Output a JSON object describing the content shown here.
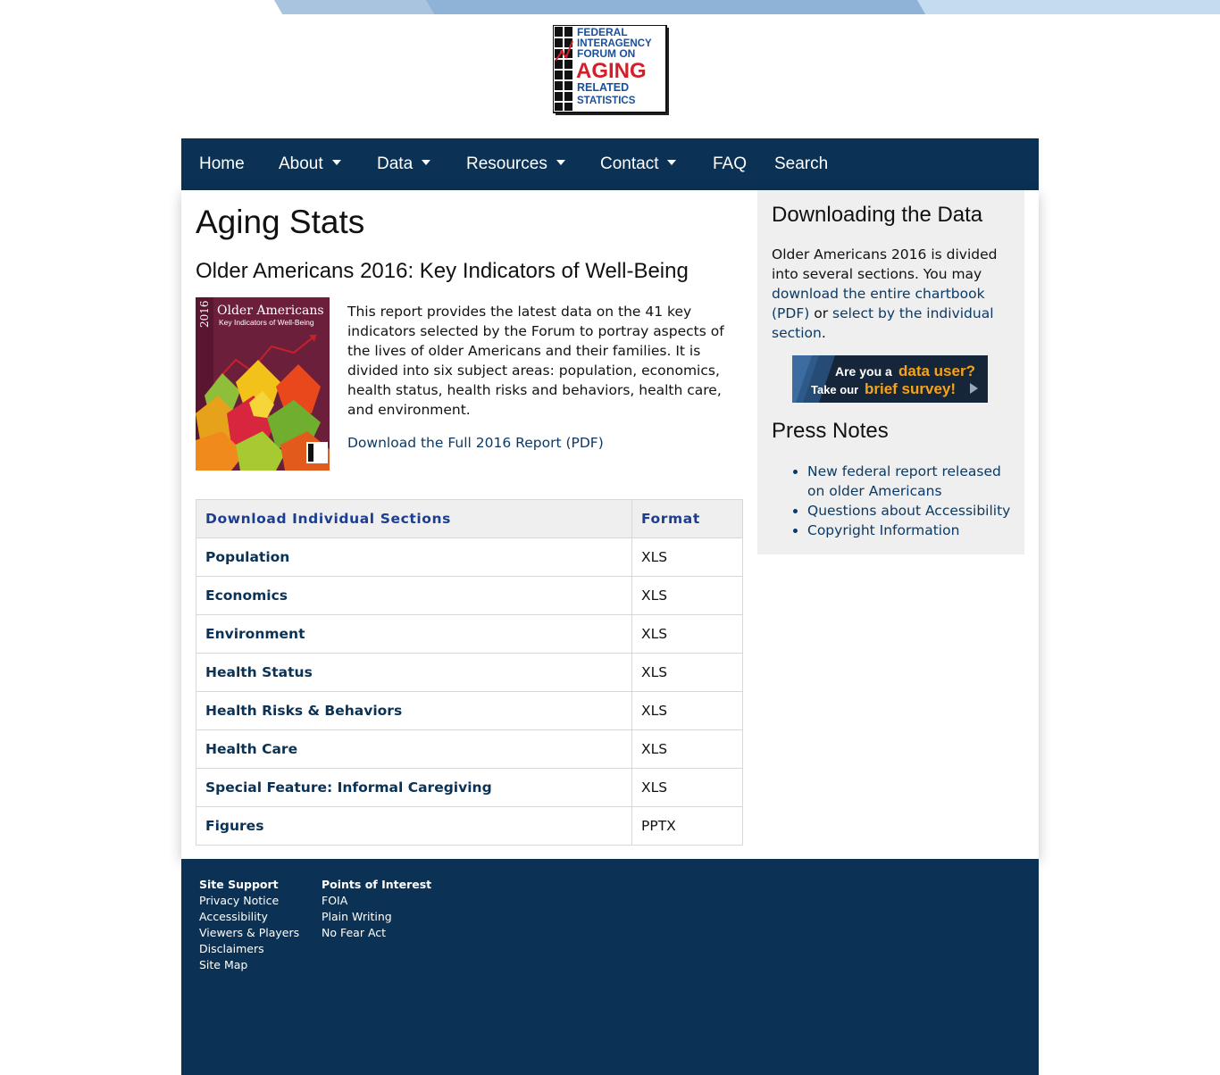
{
  "logo": {
    "alt_lines": [
      "FEDERAL",
      "INTERAGENCY",
      "FORUM ON",
      "AGING",
      "RELATED",
      "STATISTICS"
    ]
  },
  "nav": {
    "items": [
      {
        "label": "Home",
        "dropdown": false
      },
      {
        "label": "About",
        "dropdown": true
      },
      {
        "label": "Data",
        "dropdown": true
      },
      {
        "label": "Resources",
        "dropdown": true
      },
      {
        "label": "Contact",
        "dropdown": true
      },
      {
        "label": "FAQ",
        "dropdown": false
      },
      {
        "label": "Search",
        "dropdown": false
      }
    ]
  },
  "main": {
    "title": "Aging Stats",
    "subtitle": "Older Americans 2016: Key Indicators of Well-Being",
    "cover": {
      "year": "2016",
      "title": "Older Americans",
      "subtitle": "Key Indicators of Well-Being"
    },
    "intro": "This report provides the latest data on the 41 key indicators selected by the Forum to portray aspects of the lives of older Americans and their families. It is divided into six subject areas: population, economics, health status, health risks and behaviors, health care, and environment.",
    "full_report_link": "Download the Full 2016 Report (PDF)",
    "table": {
      "headers": [
        "Download Individual Sections",
        "Format"
      ],
      "rows": [
        {
          "name": "Population",
          "format": "XLS"
        },
        {
          "name": "Economics",
          "format": "XLS"
        },
        {
          "name": "Environment",
          "format": "XLS"
        },
        {
          "name": "Health Status",
          "format": "XLS"
        },
        {
          "name": "Health Risks & Behaviors",
          "format": "XLS"
        },
        {
          "name": "Health Care",
          "format": "XLS"
        },
        {
          "name": "Special Feature: Informal Caregiving",
          "format": "XLS"
        },
        {
          "name": "Figures",
          "format": "PPTX"
        }
      ]
    }
  },
  "sidebar": {
    "download_heading": "Downloading the Data",
    "download_text_1": "Older Americans 2016 is divided into several sections. You may ",
    "download_link_1": "download the entire chartbook (PDF)",
    "download_text_2": " or ",
    "download_link_2": "select by the individual section",
    "download_text_3": ".",
    "survey": {
      "line1_a": "Are you a ",
      "line1_b": "data user?",
      "line2_a": "Take our ",
      "line2_b": "brief survey!"
    },
    "press_heading": "Press Notes",
    "press_items": [
      "New federal report released on older Americans",
      "Questions about Accessibility",
      "Copyright Information"
    ]
  },
  "footer": {
    "site_support": {
      "heading": "Site Support",
      "links": [
        "Privacy Notice",
        "Accessibility",
        "Viewers & Players",
        "Disclaimers",
        "Site Map"
      ]
    },
    "points_of_interest": {
      "heading": "Points of Interest",
      "links": [
        "FOIA",
        "Plain Writing",
        "No Fear Act"
      ]
    }
  },
  "colors": {
    "navy": "#0b3254",
    "link": "#0b3a66",
    "table_header": "#1d3d8f",
    "sidebar_bg": "#efefef",
    "logo_red": "#d41f2a",
    "logo_blue": "#1a4f9c",
    "survey_orange": "#f5a31a"
  }
}
